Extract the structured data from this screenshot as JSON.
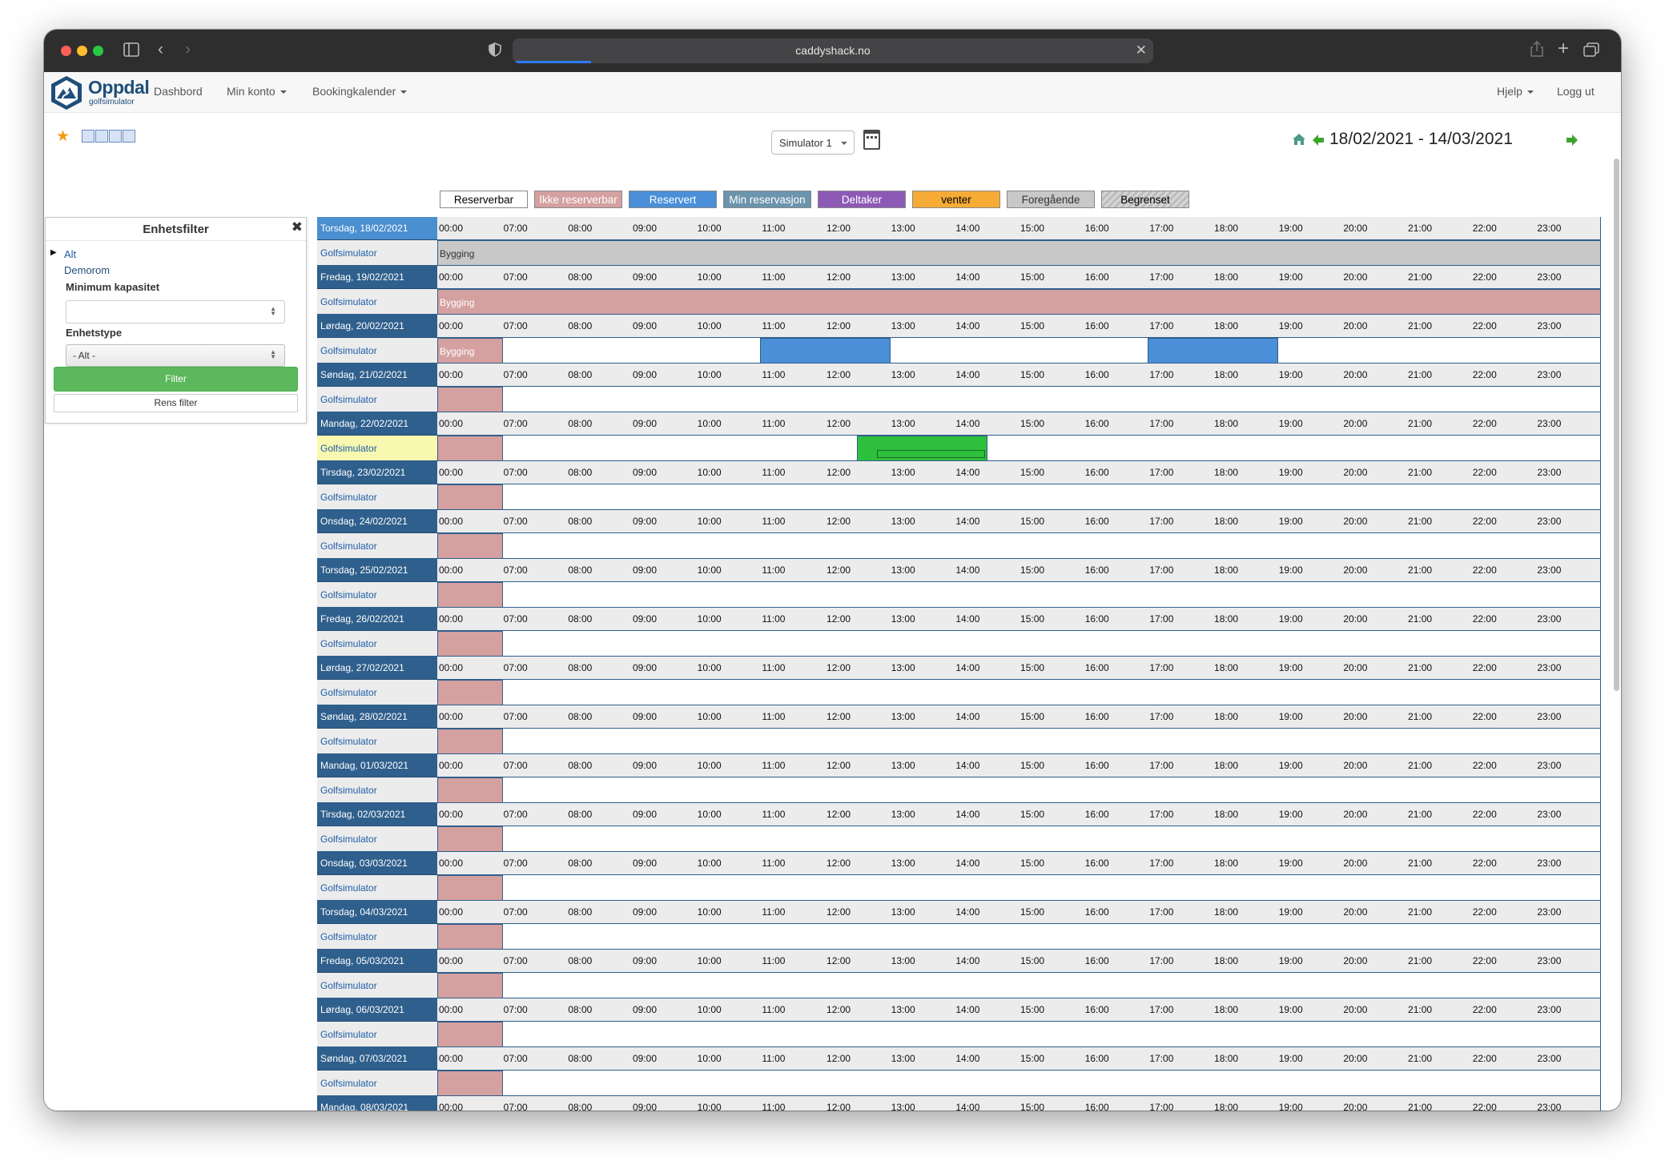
{
  "browser": {
    "url": "caddyshack.no"
  },
  "nav": {
    "logo_title": "Oppdal",
    "logo_subtitle": "golfsimulator",
    "links": [
      {
        "label": "Dashbord",
        "dropdown": false
      },
      {
        "label": "Min konto",
        "dropdown": true
      },
      {
        "label": "Bookingkalender",
        "dropdown": true
      }
    ],
    "help": "Hjelp",
    "logout": "Logg ut"
  },
  "toolbar": {
    "simulator_select": "Simulator 1",
    "date_range": "18/02/2021 - 14/03/2021",
    "icons": [
      "star-icon",
      "view-week-icon",
      "view-day-icon",
      "view-list-icon",
      "view-month-icon",
      "calendar-icon",
      "home-icon",
      "prev-arrow-icon",
      "next-arrow-icon"
    ]
  },
  "legend": [
    {
      "label": "Reserverbar",
      "bg": "#ffffff",
      "fg": "#000000"
    },
    {
      "label": "Ikke reserverbar",
      "bg": "#d4a0a0",
      "fg": "#ffffff"
    },
    {
      "label": "Reservert",
      "bg": "#4a8fd8",
      "fg": "#ffffff"
    },
    {
      "label": "Min reservasjon",
      "bg": "#6c94ad",
      "fg": "#ffffff"
    },
    {
      "label": "Deltaker",
      "bg": "#8c5ab5",
      "fg": "#ffffff"
    },
    {
      "label": "venter",
      "bg": "#f7ab37",
      "fg": "#000000"
    },
    {
      "label": "Foregående",
      "bg": "#c8c8c8",
      "fg": "#333333"
    },
    {
      "label": "Begrenset",
      "bg": "#c8c8c8",
      "fg": "#000000"
    }
  ],
  "filter": {
    "title": "Enhetsfilter",
    "tree_all": "Alt",
    "tree_child": "Demorom",
    "min_capacity_label": "Minimum kapasitet",
    "min_capacity_value": "",
    "unit_type_label": "Enhetstype",
    "unit_type_value": "- Alt -",
    "filter_button": "Filter",
    "clear_button": "Rens filter"
  },
  "calendar": {
    "hours": [
      "00:00",
      "07:00",
      "08:00",
      "09:00",
      "10:00",
      "11:00",
      "12:00",
      "13:00",
      "14:00",
      "15:00",
      "16:00",
      "17:00",
      "18:00",
      "19:00",
      "20:00",
      "21:00",
      "22:00",
      "23:00"
    ],
    "resource": "Golfsimulator",
    "colors": {
      "not_bookable": "#d4a0a0",
      "reserved": "#4a8fd8",
      "my_reservation": "#2ec03c",
      "past": "#c8c8c8"
    },
    "days": [
      {
        "date": "Torsdag, 18/02/2021",
        "blocks": [
          {
            "kind": "past",
            "from": 0,
            "to": 18,
            "label": "Bygging"
          }
        ]
      },
      {
        "date": "Fredag, 19/02/2021",
        "blocks": [
          {
            "kind": "not_bookable",
            "from": 0,
            "to": 18,
            "label": "Bygging"
          }
        ]
      },
      {
        "date": "Lørdag, 20/02/2021",
        "blocks": [
          {
            "kind": "not_bookable",
            "from": 0,
            "to": 1,
            "label": "Bygging"
          },
          {
            "kind": "reserved",
            "from": 5,
            "to": 7,
            "label": ""
          },
          {
            "kind": "reserved",
            "from": 11,
            "to": 13,
            "label": ""
          }
        ]
      },
      {
        "date": "Søndag, 21/02/2021",
        "blocks": [
          {
            "kind": "not_bookable",
            "from": 0,
            "to": 1,
            "label": ""
          }
        ]
      },
      {
        "date": "Mandag, 22/02/2021",
        "highlight": true,
        "blocks": [
          {
            "kind": "not_bookable",
            "from": 0,
            "to": 1,
            "label": ""
          },
          {
            "kind": "my_reservation",
            "from": 6.5,
            "to": 8.5,
            "label": ""
          }
        ]
      },
      {
        "date": "Tirsdag, 23/02/2021",
        "blocks": [
          {
            "kind": "not_bookable",
            "from": 0,
            "to": 1,
            "label": ""
          }
        ]
      },
      {
        "date": "Onsdag, 24/02/2021",
        "blocks": [
          {
            "kind": "not_bookable",
            "from": 0,
            "to": 1,
            "label": ""
          }
        ]
      },
      {
        "date": "Torsdag, 25/02/2021",
        "blocks": [
          {
            "kind": "not_bookable",
            "from": 0,
            "to": 1,
            "label": ""
          }
        ]
      },
      {
        "date": "Fredag, 26/02/2021",
        "blocks": [
          {
            "kind": "not_bookable",
            "from": 0,
            "to": 1,
            "label": ""
          }
        ]
      },
      {
        "date": "Lørdag, 27/02/2021",
        "blocks": [
          {
            "kind": "not_bookable",
            "from": 0,
            "to": 1,
            "label": ""
          }
        ]
      },
      {
        "date": "Søndag, 28/02/2021",
        "blocks": [
          {
            "kind": "not_bookable",
            "from": 0,
            "to": 1,
            "label": ""
          }
        ]
      },
      {
        "date": "Mandag, 01/03/2021",
        "blocks": [
          {
            "kind": "not_bookable",
            "from": 0,
            "to": 1,
            "label": ""
          }
        ]
      },
      {
        "date": "Tirsdag, 02/03/2021",
        "blocks": [
          {
            "kind": "not_bookable",
            "from": 0,
            "to": 1,
            "label": ""
          }
        ]
      },
      {
        "date": "Onsdag, 03/03/2021",
        "blocks": [
          {
            "kind": "not_bookable",
            "from": 0,
            "to": 1,
            "label": ""
          }
        ]
      },
      {
        "date": "Torsdag, 04/03/2021",
        "blocks": [
          {
            "kind": "not_bookable",
            "from": 0,
            "to": 1,
            "label": ""
          }
        ]
      },
      {
        "date": "Fredag, 05/03/2021",
        "blocks": [
          {
            "kind": "not_bookable",
            "from": 0,
            "to": 1,
            "label": ""
          }
        ]
      },
      {
        "date": "Lørdag, 06/03/2021",
        "blocks": [
          {
            "kind": "not_bookable",
            "from": 0,
            "to": 1,
            "label": ""
          }
        ]
      },
      {
        "date": "Søndag, 07/03/2021",
        "blocks": [
          {
            "kind": "not_bookable",
            "from": 0,
            "to": 1,
            "label": ""
          }
        ]
      },
      {
        "date": "Mandag, 08/03/2021",
        "blocks": [
          {
            "kind": "not_bookable",
            "from": 0,
            "to": 1,
            "label": ""
          }
        ]
      }
    ]
  }
}
